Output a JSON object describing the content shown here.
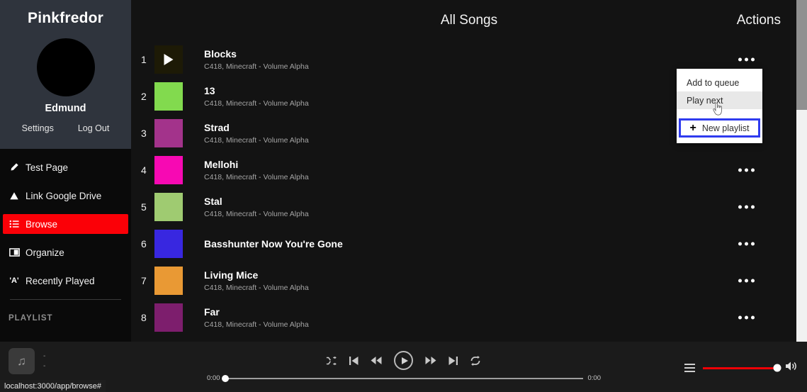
{
  "sidebar": {
    "brand": "Pinkfredor",
    "user_name": "Edmund",
    "settings_label": "Settings",
    "logout_label": "Log Out",
    "nav": [
      {
        "label": "Test Page",
        "icon": "pencil-icon",
        "active": false
      },
      {
        "label": "Link Google Drive",
        "icon": "google-drive-icon",
        "active": false
      },
      {
        "label": "Browse",
        "icon": "list-icon",
        "active": true
      },
      {
        "label": "Organize",
        "icon": "columns-icon",
        "active": false
      },
      {
        "label": "Recently Played",
        "icon": "quoted-a-icon",
        "active": false
      }
    ],
    "playlist_heading": "PLAYLIST",
    "active_color": "#fb0007"
  },
  "header": {
    "title": "All Songs",
    "actions_label": "Actions"
  },
  "songs": [
    {
      "num": "1",
      "title": "Blocks",
      "subtitle": "C418, Minecraft - Volume Alpha",
      "color": "#1d1a06",
      "hovered": true
    },
    {
      "num": "2",
      "title": "13",
      "subtitle": "C418, Minecraft - Volume Alpha",
      "color": "#82da4e",
      "hovered": false
    },
    {
      "num": "3",
      "title": "Strad",
      "subtitle": "C418, Minecraft - Volume Alpha",
      "color": "#a3338b",
      "hovered": false
    },
    {
      "num": "4",
      "title": "Mellohi",
      "subtitle": "C418, Minecraft - Volume Alpha",
      "color": "#f709b3",
      "hovered": false
    },
    {
      "num": "5",
      "title": "Stal",
      "subtitle": "C418, Minecraft - Volume Alpha",
      "color": "#9fcb71",
      "hovered": false
    },
    {
      "num": "6",
      "title": "Basshunter Now You're Gone",
      "subtitle": "",
      "color": "#3827e0",
      "hovered": false
    },
    {
      "num": "7",
      "title": "Living Mice",
      "subtitle": "C418, Minecraft - Volume Alpha",
      "color": "#e99934",
      "hovered": false
    },
    {
      "num": "8",
      "title": "Far",
      "subtitle": "C418, Minecraft - Volume Alpha",
      "color": "#7d1e6d",
      "hovered": false
    }
  ],
  "context_menu": {
    "add_to_queue": "Add to queue",
    "play_next": "Play next",
    "new_playlist": "New playlist",
    "plus": "+",
    "focus_color": "#2f3bef"
  },
  "player": {
    "now_playing_line1": "-",
    "now_playing_line2": "-",
    "music_note_icon": "♫",
    "elapsed": "0:00",
    "duration": "0:00",
    "controls": [
      {
        "name": "shuffle-button"
      },
      {
        "name": "previous-track-button"
      },
      {
        "name": "rewind-button"
      },
      {
        "name": "play-button"
      },
      {
        "name": "fast-forward-button"
      },
      {
        "name": "next-track-button"
      },
      {
        "name": "repeat-button"
      }
    ],
    "volume_color": "#ee0006"
  },
  "status_bar": {
    "url": "localhost:3000/app/browse#"
  }
}
